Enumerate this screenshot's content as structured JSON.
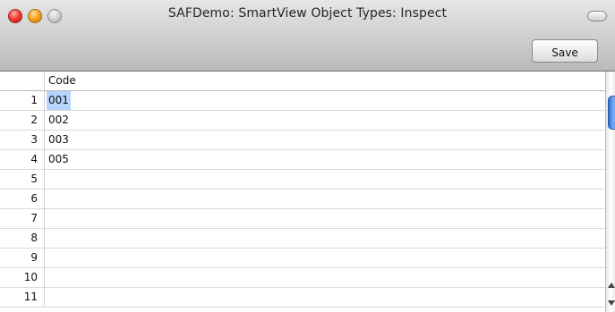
{
  "window": {
    "title": "SAFDemo: SmartView Object Types: Inspect"
  },
  "toolbar": {
    "save_label": "Save"
  },
  "grid": {
    "column_header": "Code",
    "rows": [
      {
        "num": "1",
        "code": "001"
      },
      {
        "num": "2",
        "code": "002"
      },
      {
        "num": "3",
        "code": "003"
      },
      {
        "num": "4",
        "code": "005"
      },
      {
        "num": "5",
        "code": ""
      },
      {
        "num": "6",
        "code": ""
      },
      {
        "num": "7",
        "code": ""
      },
      {
        "num": "8",
        "code": ""
      },
      {
        "num": "9",
        "code": ""
      },
      {
        "num": "10",
        "code": ""
      },
      {
        "num": "11",
        "code": ""
      }
    ]
  },
  "colors": {
    "selection": "#b5d4fe",
    "scroll_thumb": "#4a8ae6"
  },
  "icons": {
    "close": "close-icon",
    "minimize": "minimize-icon",
    "zoom": "zoom-icon",
    "toolbar_toggle": "toolbar-toggle-icon",
    "scroll_up": "scroll-up-arrow-icon",
    "scroll_down": "scroll-down-arrow-icon"
  }
}
